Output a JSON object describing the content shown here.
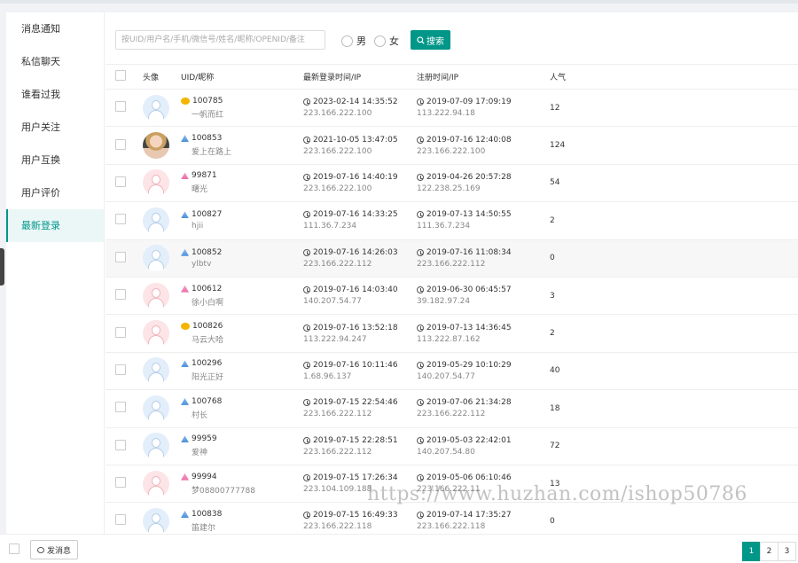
{
  "sidebar": {
    "items": [
      {
        "label": "消息通知"
      },
      {
        "label": "私信聊天"
      },
      {
        "label": "谁看过我"
      },
      {
        "label": "用户关注"
      },
      {
        "label": "用户互换"
      },
      {
        "label": "用户评价"
      },
      {
        "label": "最新登录"
      }
    ],
    "active_index": 6
  },
  "search": {
    "placeholder": "按UID/用户名/手机/微信号/姓名/昵称/OPENID/备注",
    "gender_male": "男",
    "gender_female": "女",
    "button_label": "搜索"
  },
  "table": {
    "headers": {
      "avatar": "头像",
      "uid": "UID/昵称",
      "login": "最新登录时间/IP",
      "register": "注册时间/IP",
      "popularity": "人气"
    },
    "rows": [
      {
        "uid": "100785",
        "nickname": "一帆而红",
        "avatar": "blue",
        "vip": "gold",
        "login_time": "2023-02-14 14:35:52",
        "login_ip": "223.166.222.100",
        "reg_time": "2019-07-09 17:09:19",
        "reg_ip": "113.222.94.18",
        "popularity": "12"
      },
      {
        "uid": "100853",
        "nickname": "爱上在路上",
        "avatar": "photo",
        "vip": "blue",
        "login_time": "2021-10-05 13:47:05",
        "login_ip": "223.166.222.100",
        "reg_time": "2019-07-16 12:40:08",
        "reg_ip": "223.166.222.100",
        "popularity": "124"
      },
      {
        "uid": "99871",
        "nickname": "曙光",
        "avatar": "pink",
        "vip": "pink",
        "login_time": "2019-07-16 14:40:19",
        "login_ip": "223.166.222.100",
        "reg_time": "2019-04-26 20:57:28",
        "reg_ip": "122.238.25.169",
        "popularity": "54"
      },
      {
        "uid": "100827",
        "nickname": "hjii",
        "avatar": "blue",
        "vip": "blue",
        "login_time": "2019-07-16 14:33:25",
        "login_ip": "111.36.7.234",
        "reg_time": "2019-07-13 14:50:55",
        "reg_ip": "111.36.7.234",
        "popularity": "2"
      },
      {
        "uid": "100852",
        "nickname": "ylbtv",
        "avatar": "blue",
        "vip": "blue",
        "login_time": "2019-07-16 14:26:03",
        "login_ip": "223.166.222.112",
        "reg_time": "2019-07-16 11:08:34",
        "reg_ip": "223.166.222.112",
        "popularity": "0"
      },
      {
        "uid": "100612",
        "nickname": "徐小白啊",
        "avatar": "pink",
        "vip": "pink",
        "login_time": "2019-07-16 14:03:40",
        "login_ip": "140.207.54.77",
        "reg_time": "2019-06-30 06:45:57",
        "reg_ip": "39.182.97.24",
        "popularity": "3"
      },
      {
        "uid": "100826",
        "nickname": "马云大哈",
        "avatar": "pink",
        "vip": "gold",
        "login_time": "2019-07-16 13:52:18",
        "login_ip": "113.222.94.247",
        "reg_time": "2019-07-13 14:36:45",
        "reg_ip": "113.222.87.162",
        "popularity": "2"
      },
      {
        "uid": "100296",
        "nickname": "阳光正好",
        "avatar": "blue",
        "vip": "blue",
        "login_time": "2019-07-16 10:11:46",
        "login_ip": "1.68.96.137",
        "reg_time": "2019-05-29 10:10:29",
        "reg_ip": "140.207.54.77",
        "popularity": "40"
      },
      {
        "uid": "100768",
        "nickname": "村长",
        "avatar": "blue",
        "vip": "blue",
        "login_time": "2019-07-15 22:54:46",
        "login_ip": "223.166.222.112",
        "reg_time": "2019-07-06 21:34:28",
        "reg_ip": "223.166.222.112",
        "popularity": "18"
      },
      {
        "uid": "99959",
        "nickname": "爱神",
        "avatar": "blue",
        "vip": "blue",
        "login_time": "2019-07-15 22:28:51",
        "login_ip": "223.166.222.112",
        "reg_time": "2019-05-03 22:42:01",
        "reg_ip": "140.207.54.80",
        "popularity": "72"
      },
      {
        "uid": "99994",
        "nickname": "梦08800777788",
        "avatar": "pink",
        "vip": "pink",
        "login_time": "2019-07-15 17:26:34",
        "login_ip": "223.104.109.188",
        "reg_time": "2019-05-06 06:10:46",
        "reg_ip": "223.166.222.11",
        "popularity": "13"
      },
      {
        "uid": "100838",
        "nickname": "笛建尔",
        "avatar": "blue",
        "vip": "blue",
        "login_time": "2019-07-15 16:49:33",
        "login_ip": "223.166.222.118",
        "reg_time": "2019-07-14 17:35:27",
        "reg_ip": "223.166.222.118",
        "popularity": "0"
      }
    ]
  },
  "footer": {
    "send_message_label": "发消息",
    "pages": [
      "1",
      "2",
      "3"
    ],
    "current_page": "1"
  },
  "watermark": "https://www.huzhan.com/ishop50786",
  "colors": {
    "accent": "#009688"
  }
}
